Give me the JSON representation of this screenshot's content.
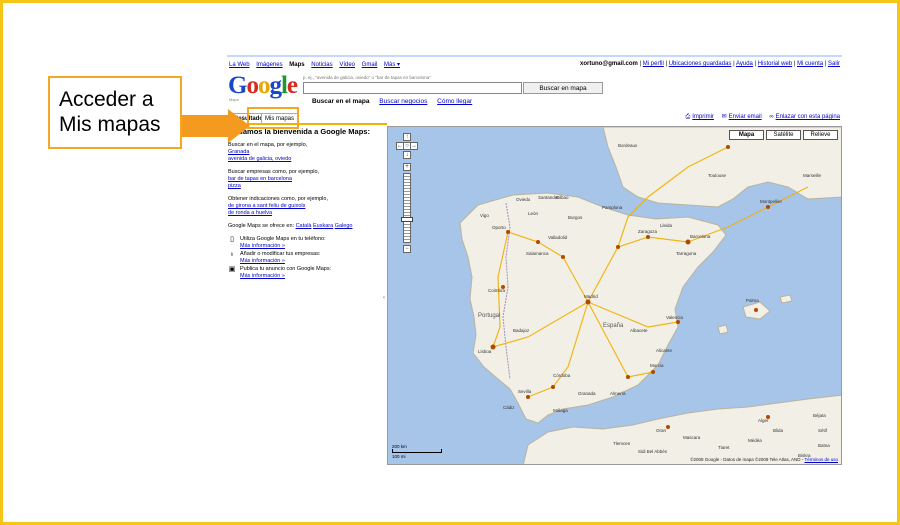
{
  "callout": {
    "line1": "Acceder a",
    "line2": "Mis mapas"
  },
  "topnav": {
    "links": [
      "La Web",
      "Imágenes",
      "Maps",
      "Noticias",
      "Vídeo",
      "Gmail",
      "Más ▾"
    ],
    "current": "Maps",
    "user_email": "xortuno@gmail.com",
    "right_links": [
      "Mi perfil",
      "Ubicaciones guardadas",
      "Ayuda",
      "Historial web",
      "Mi cuenta",
      "Salir"
    ]
  },
  "logo": {
    "text": "Google",
    "sub": "Maps"
  },
  "search": {
    "hint": "p. ej., \"avenida de galicia, oviedo\" o \"bar de tapas en barcelona\"",
    "value": "",
    "button_label": "Buscar en mapa"
  },
  "modes": [
    "Buscar en el mapa",
    "Buscar negocios",
    "Cómo llegar"
  ],
  "modes_selected": "Buscar en el mapa",
  "tabs": {
    "results": "Resultados",
    "my_maps": "Mis mapas"
  },
  "actions": {
    "print": "Imprimir",
    "email": "Enviar email",
    "link": "Enlazar con esta página"
  },
  "sidebar": {
    "title": "Te damos la bienvenida a Google Maps:",
    "block1": {
      "text": "Buscar en el mapa, por ejemplo,",
      "links": [
        "Granada",
        "avenida de galicia, oviedo"
      ]
    },
    "block2": {
      "text": "Buscar empresas como, por ejemplo,",
      "links": [
        "bar de tapas en barcelona",
        "pizza"
      ]
    },
    "block3": {
      "text": "Obtener indicaciones como, por ejemplo,",
      "links": [
        "de girona a sant feliu de guixols",
        "de ronda a huelva"
      ]
    },
    "languages": {
      "text": "Google Maps se ofrece en:",
      "links": [
        "Català",
        "Euskara",
        "Galego"
      ]
    },
    "promos": [
      {
        "icon": "phone-icon",
        "text": "Utiliza Google Maps en tu teléfono:",
        "link": "Más información »"
      },
      {
        "icon": "pin-icon",
        "text": "Añadir o modificar tus empresas:",
        "link": "Más información »"
      },
      {
        "icon": "ad-icon",
        "text": "Publica tu anuncio con Google Maps:",
        "link": "Más información »"
      }
    ]
  },
  "map": {
    "types": [
      "Mapa",
      "Satélite",
      "Relieve"
    ],
    "active_type": "Mapa",
    "scale": {
      "km": "200 km",
      "mi": "100 mi"
    },
    "copyright": "©2008 Google - Datos de mapa ©2008 Tele Atlas, AND -",
    "terms": "Términos de uso",
    "labels": {
      "portugal": "Portugal",
      "espana": "España",
      "lisboa": "Lisboa",
      "madrid": "Madrid",
      "zaragoza": "Zaragoza",
      "barcelona": "Barcelona",
      "valencia": "Valencia",
      "sevilla": "Sevilla",
      "oporto": "Oporto",
      "bilbao": "Bilbao",
      "bordeaux": "Bordeaux",
      "toulouse": "Toulouse",
      "salamanca": "Salamanca",
      "valladolid": "Valladolid",
      "malaga": "Málaga",
      "murcia": "Murcia",
      "granada": "Granada",
      "cordoba": "Córdoba",
      "alicante": "Alicante",
      "coimbra": "Coimbra",
      "oran": "Oran",
      "alger": "Alger",
      "marseille": "Marseille",
      "montpellier": "Montpellier",
      "palma": "Palma",
      "burgos": "Burgos",
      "leon": "León",
      "santander": "Santander",
      "oviedo": "Oviedo",
      "vigo": "Vigo",
      "badajoz": "Badajoz",
      "albacete": "Albacete",
      "tarragona": "Tarragona",
      "cadiz": "Cádiz",
      "almeria": "Almería",
      "pamplona": "Pamplona",
      "lleida": "Lleida",
      "tlemcen": "Tlemcen",
      "tiaret": "Tiaret",
      "sidi": "Sidi Bel Abbès",
      "mascara": "Mascara",
      "blida": "Blida",
      "bejaia": "Béjaïa",
      "setif": "Sétif",
      "biskra": "Biskra",
      "batna": "Batna",
      "medea": "Médéa"
    }
  }
}
